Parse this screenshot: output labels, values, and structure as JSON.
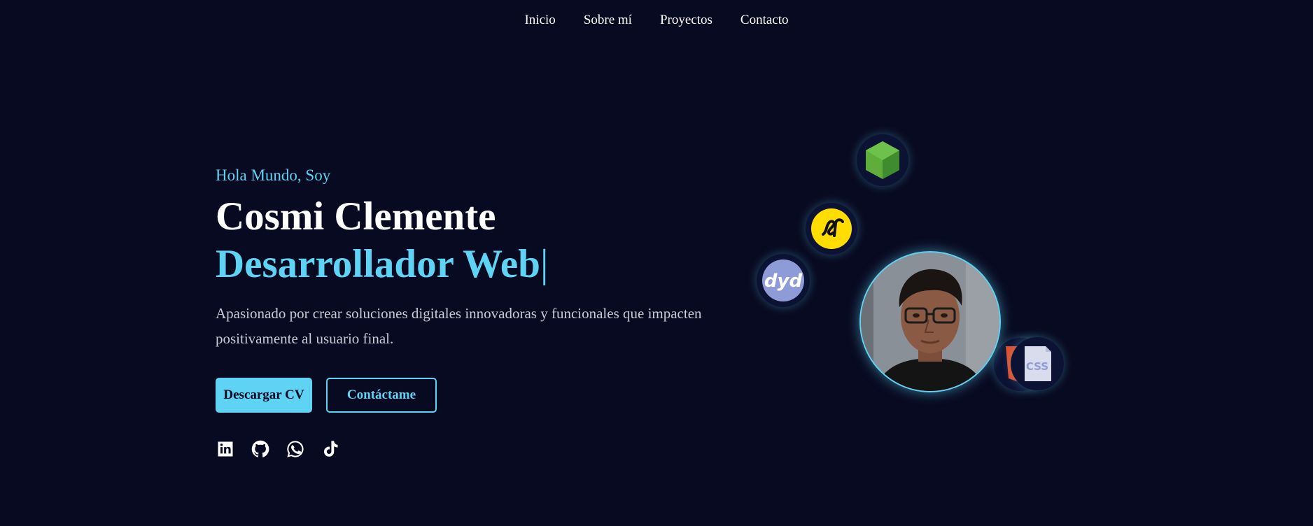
{
  "nav": {
    "items": [
      {
        "label": "Inicio"
      },
      {
        "label": "Sobre mí"
      },
      {
        "label": "Proyectos"
      },
      {
        "label": "Contacto"
      }
    ]
  },
  "hero": {
    "greeting": "Hola Mundo, Soy",
    "name": "Cosmi Clemente",
    "role": "Desarrollador Web",
    "caret": "|",
    "description": "Apasionado por crear soluciones digitales innovadoras y funcionales que impacten positivamente al usuario final."
  },
  "buttons": {
    "download_cv": "Descargar CV",
    "contact": "Contáctame"
  },
  "socials": [
    {
      "icon": "linkedin-icon"
    },
    {
      "icon": "github-icon"
    },
    {
      "icon": "whatsapp-icon"
    },
    {
      "icon": "tiktok-icon"
    }
  ],
  "tech_icons": [
    {
      "icon": "nodejs-icon"
    },
    {
      "icon": "symfony-icon"
    },
    {
      "icon": "dyd-icon"
    },
    {
      "icon": "html5-icon"
    },
    {
      "icon": "css3-icon",
      "label": "CSS"
    }
  ],
  "colors": {
    "background": "#080a21",
    "accent": "#5fd3f3",
    "text": "#ffffff",
    "muted": "#c8cad6"
  }
}
